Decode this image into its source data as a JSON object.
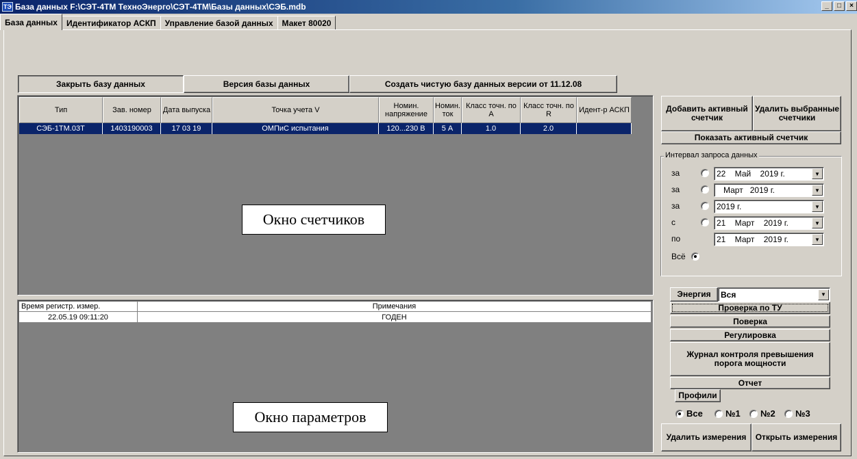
{
  "window": {
    "title": "База данных F:\\СЭТ-4ТМ ТехноЭнерго\\СЭТ-4ТМ\\Базы данных\\СЭБ.mdb",
    "icon_text": "ТЭ",
    "minimize": "_",
    "maximize": "□",
    "close": "×"
  },
  "tabs": [
    {
      "label": "База данных"
    },
    {
      "label": "Идентификатор АСКП"
    },
    {
      "label": "Управление базой данных"
    },
    {
      "label": "Макет 80020"
    }
  ],
  "toolbar": {
    "close_db": "Закрыть базу данных",
    "db_version": "Версия базы данных",
    "create_db": "Создать чистую базу данных версии от 11.12.08"
  },
  "meters": {
    "columns": [
      "Тип",
      "Зав. номер",
      "Дата выпуска",
      "Точка учета V",
      "Номин. напряжение",
      "Номин. ток",
      "Класс точн. по А",
      "Класс точн. по R",
      "Идент-р АСКП"
    ],
    "rows": [
      [
        "СЭБ-1ТМ.03Т",
        "1403190003",
        "17 03 19",
        "ОМПиС испытания",
        "120...230 В",
        "5 А",
        "1.0",
        "2.0",
        ""
      ]
    ],
    "overlay": "Окно счетчиков"
  },
  "params": {
    "columns": [
      "Время регистр. измер.",
      "Примечания"
    ],
    "rows": [
      [
        "22.05.19 09:11:20",
        "ГОДЕН"
      ]
    ],
    "overlay": "Окно параметров"
  },
  "right": {
    "add_active": "Добавить активный счетчик",
    "delete_selected": "Удалить выбранные счетчики",
    "show_active": "Показать активный счетчик",
    "interval": {
      "label": "Интервал запроса данных",
      "rows": [
        {
          "prefix": "за",
          "value": "22    Май    2019 г.",
          "selected": false
        },
        {
          "prefix": "за",
          "value": "   Март   2019 г.",
          "selected": false
        },
        {
          "prefix": "за",
          "value": "2019 г.",
          "selected": false
        },
        {
          "prefix": "с",
          "value": "21    Март    2019 г.",
          "selected": false
        },
        {
          "prefix": "по",
          "value": "21    Март    2019 г.",
          "selected": false
        }
      ],
      "all_label": "Всё",
      "all_selected": true
    },
    "energy_label": "Энергия",
    "energy_value": "Вся",
    "buttons": {
      "check_tu": "Проверка по ТУ",
      "verification": "Поверка",
      "adjustment": "Регулировка",
      "journal": "Журнал контроля превышения порога мощности",
      "report": "Отчет",
      "profiles": "Профили"
    },
    "profile_radios": [
      {
        "label": "Все",
        "selected": true
      },
      {
        "label": "№1",
        "selected": false
      },
      {
        "label": "№2",
        "selected": false
      },
      {
        "label": "№3",
        "selected": false
      }
    ],
    "delete_measurements": "Удалить измерения",
    "open_measurements": "Открыть измерения"
  }
}
